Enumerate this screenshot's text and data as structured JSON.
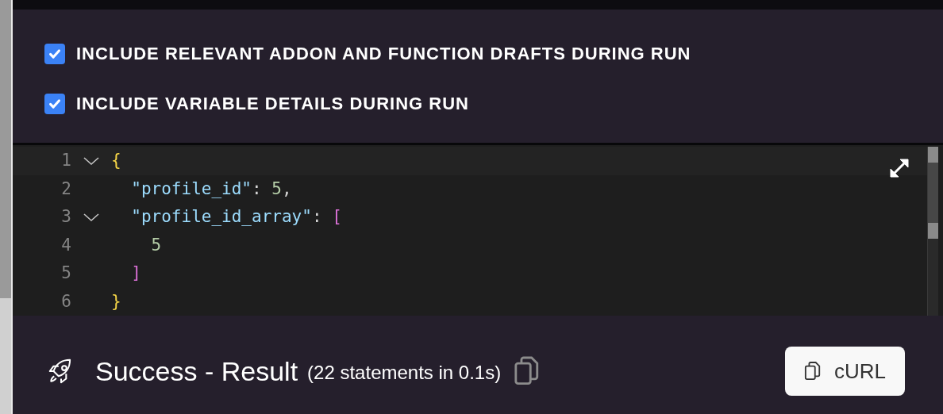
{
  "options": [
    {
      "label": "INCLUDE RELEVANT ADDON AND FUNCTION DRAFTS DURING RUN",
      "checked": true
    },
    {
      "label": "INCLUDE VARIABLE DETAILS DURING RUN",
      "checked": true
    }
  ],
  "editor": {
    "lines": [
      {
        "number": "1",
        "foldable": true,
        "tokens": [
          {
            "text": "{",
            "kind": "brace"
          }
        ]
      },
      {
        "number": "2",
        "foldable": false,
        "tokens": [
          {
            "text": "  \"profile_id\"",
            "kind": "key"
          },
          {
            "text": ": ",
            "kind": "punct"
          },
          {
            "text": "5",
            "kind": "number"
          },
          {
            "text": ",",
            "kind": "punct"
          }
        ]
      },
      {
        "number": "3",
        "foldable": true,
        "tokens": [
          {
            "text": "  \"profile_id_array\"",
            "kind": "key"
          },
          {
            "text": ": ",
            "kind": "punct"
          },
          {
            "text": "[",
            "kind": "bracket"
          }
        ]
      },
      {
        "number": "4",
        "foldable": false,
        "tokens": [
          {
            "text": "    5",
            "kind": "number"
          }
        ]
      },
      {
        "number": "5",
        "foldable": false,
        "tokens": [
          {
            "text": "  ]",
            "kind": "bracket"
          }
        ]
      },
      {
        "number": "6",
        "foldable": false,
        "tokens": [
          {
            "text": "}",
            "kind": "brace"
          }
        ]
      }
    ]
  },
  "result": {
    "title": "Success - Result",
    "detail": "(22 statements in 0.1s)",
    "curl_button": "cURL"
  }
}
